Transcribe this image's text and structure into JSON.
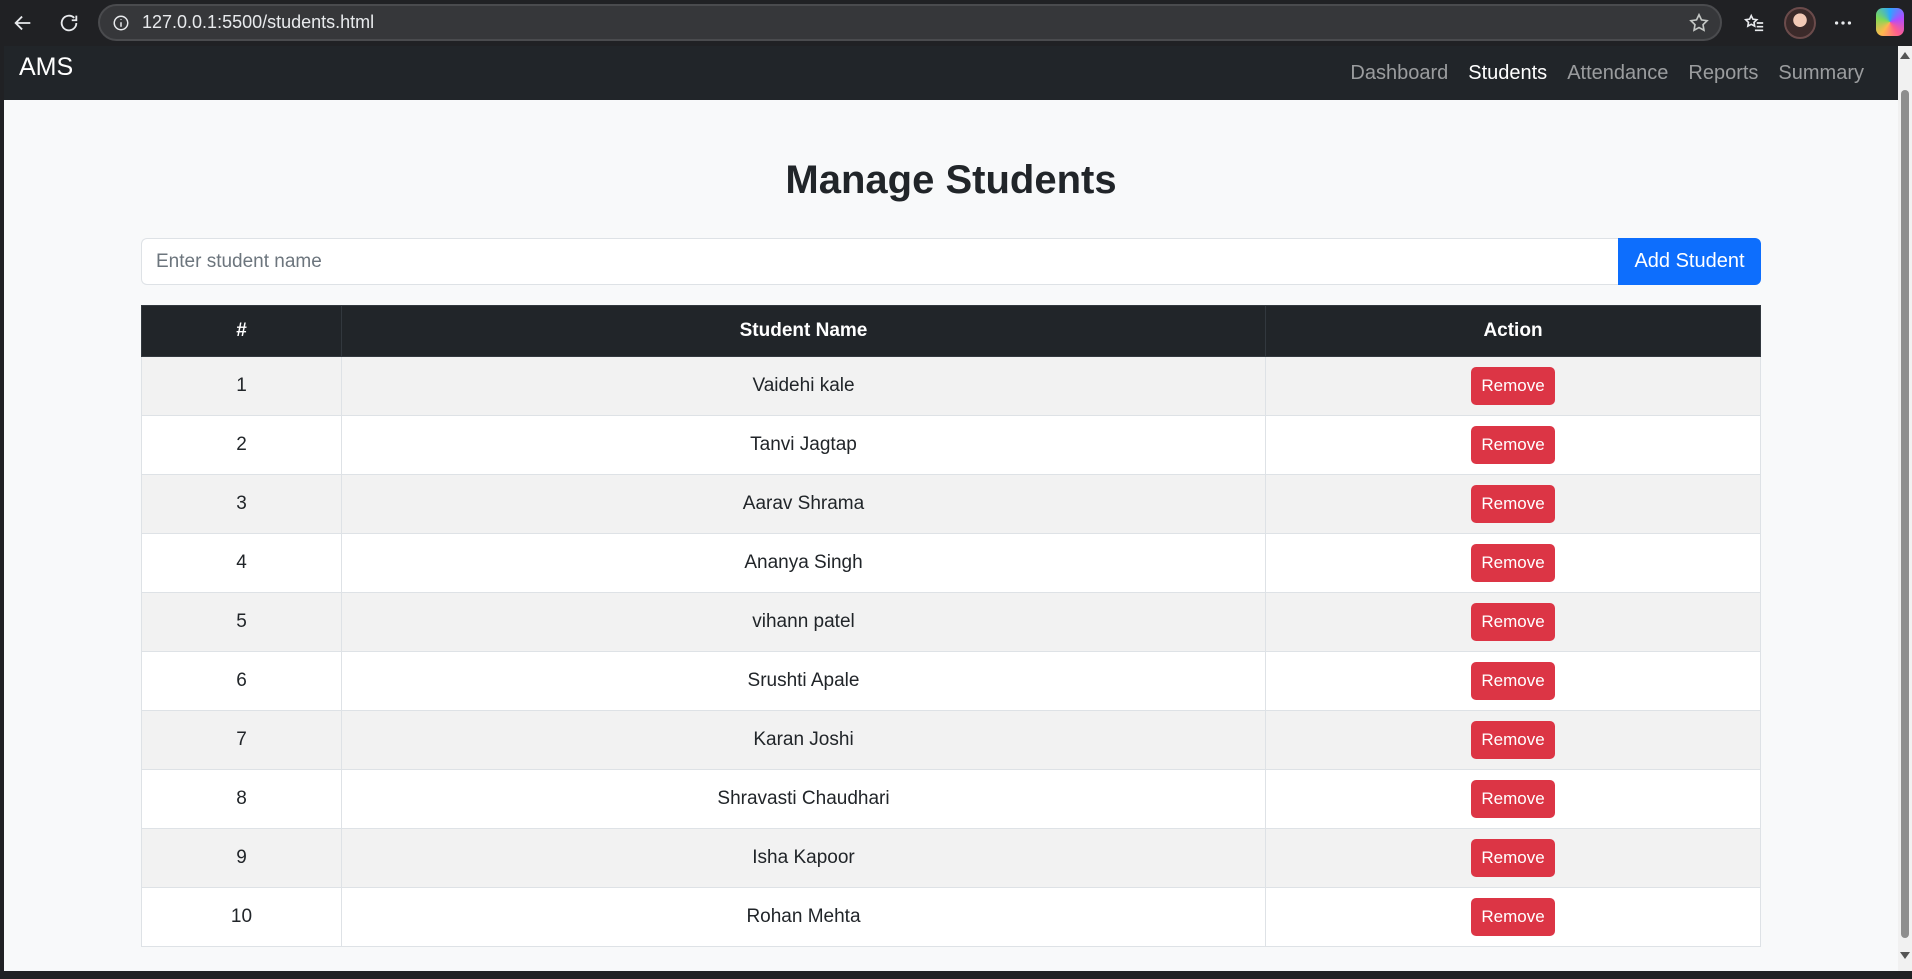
{
  "browser": {
    "url": "127.0.0.1:5500/students.html",
    "icons": [
      "back-icon",
      "reload-icon",
      "site-info-icon",
      "favorite-star-icon",
      "favorites-icon",
      "profile-avatar",
      "more-icon",
      "copilot-icon"
    ]
  },
  "navbar": {
    "brand": "AMS",
    "links": [
      {
        "label": "Dashboard",
        "active": false
      },
      {
        "label": "Students",
        "active": true
      },
      {
        "label": "Attendance",
        "active": false
      },
      {
        "label": "Reports",
        "active": false
      },
      {
        "label": "Summary",
        "active": false
      }
    ]
  },
  "main": {
    "title": "Manage Students",
    "input": {
      "placeholder": "Enter student name",
      "value": ""
    },
    "add_button": "Add Student",
    "table": {
      "headers": [
        "#",
        "Student Name",
        "Action"
      ],
      "remove_label": "Remove",
      "rows": [
        {
          "num": "1",
          "name": "Vaidehi kale"
        },
        {
          "num": "2",
          "name": "Tanvi Jagtap"
        },
        {
          "num": "3",
          "name": "Aarav Shrama"
        },
        {
          "num": "4",
          "name": "Ananya Singh"
        },
        {
          "num": "5",
          "name": "vihann patel"
        },
        {
          "num": "6",
          "name": "Srushti Apale"
        },
        {
          "num": "7",
          "name": "Karan Joshi"
        },
        {
          "num": "8",
          "name": "Shravasti Chaudhari"
        },
        {
          "num": "9",
          "name": "Isha Kapoor"
        },
        {
          "num": "10",
          "name": "Rohan Mehta"
        }
      ]
    }
  },
  "colors": {
    "navbar_bg": "#212529",
    "primary": "#0d6efd",
    "danger": "#dc3545",
    "page_bg": "#f8f9fa"
  }
}
